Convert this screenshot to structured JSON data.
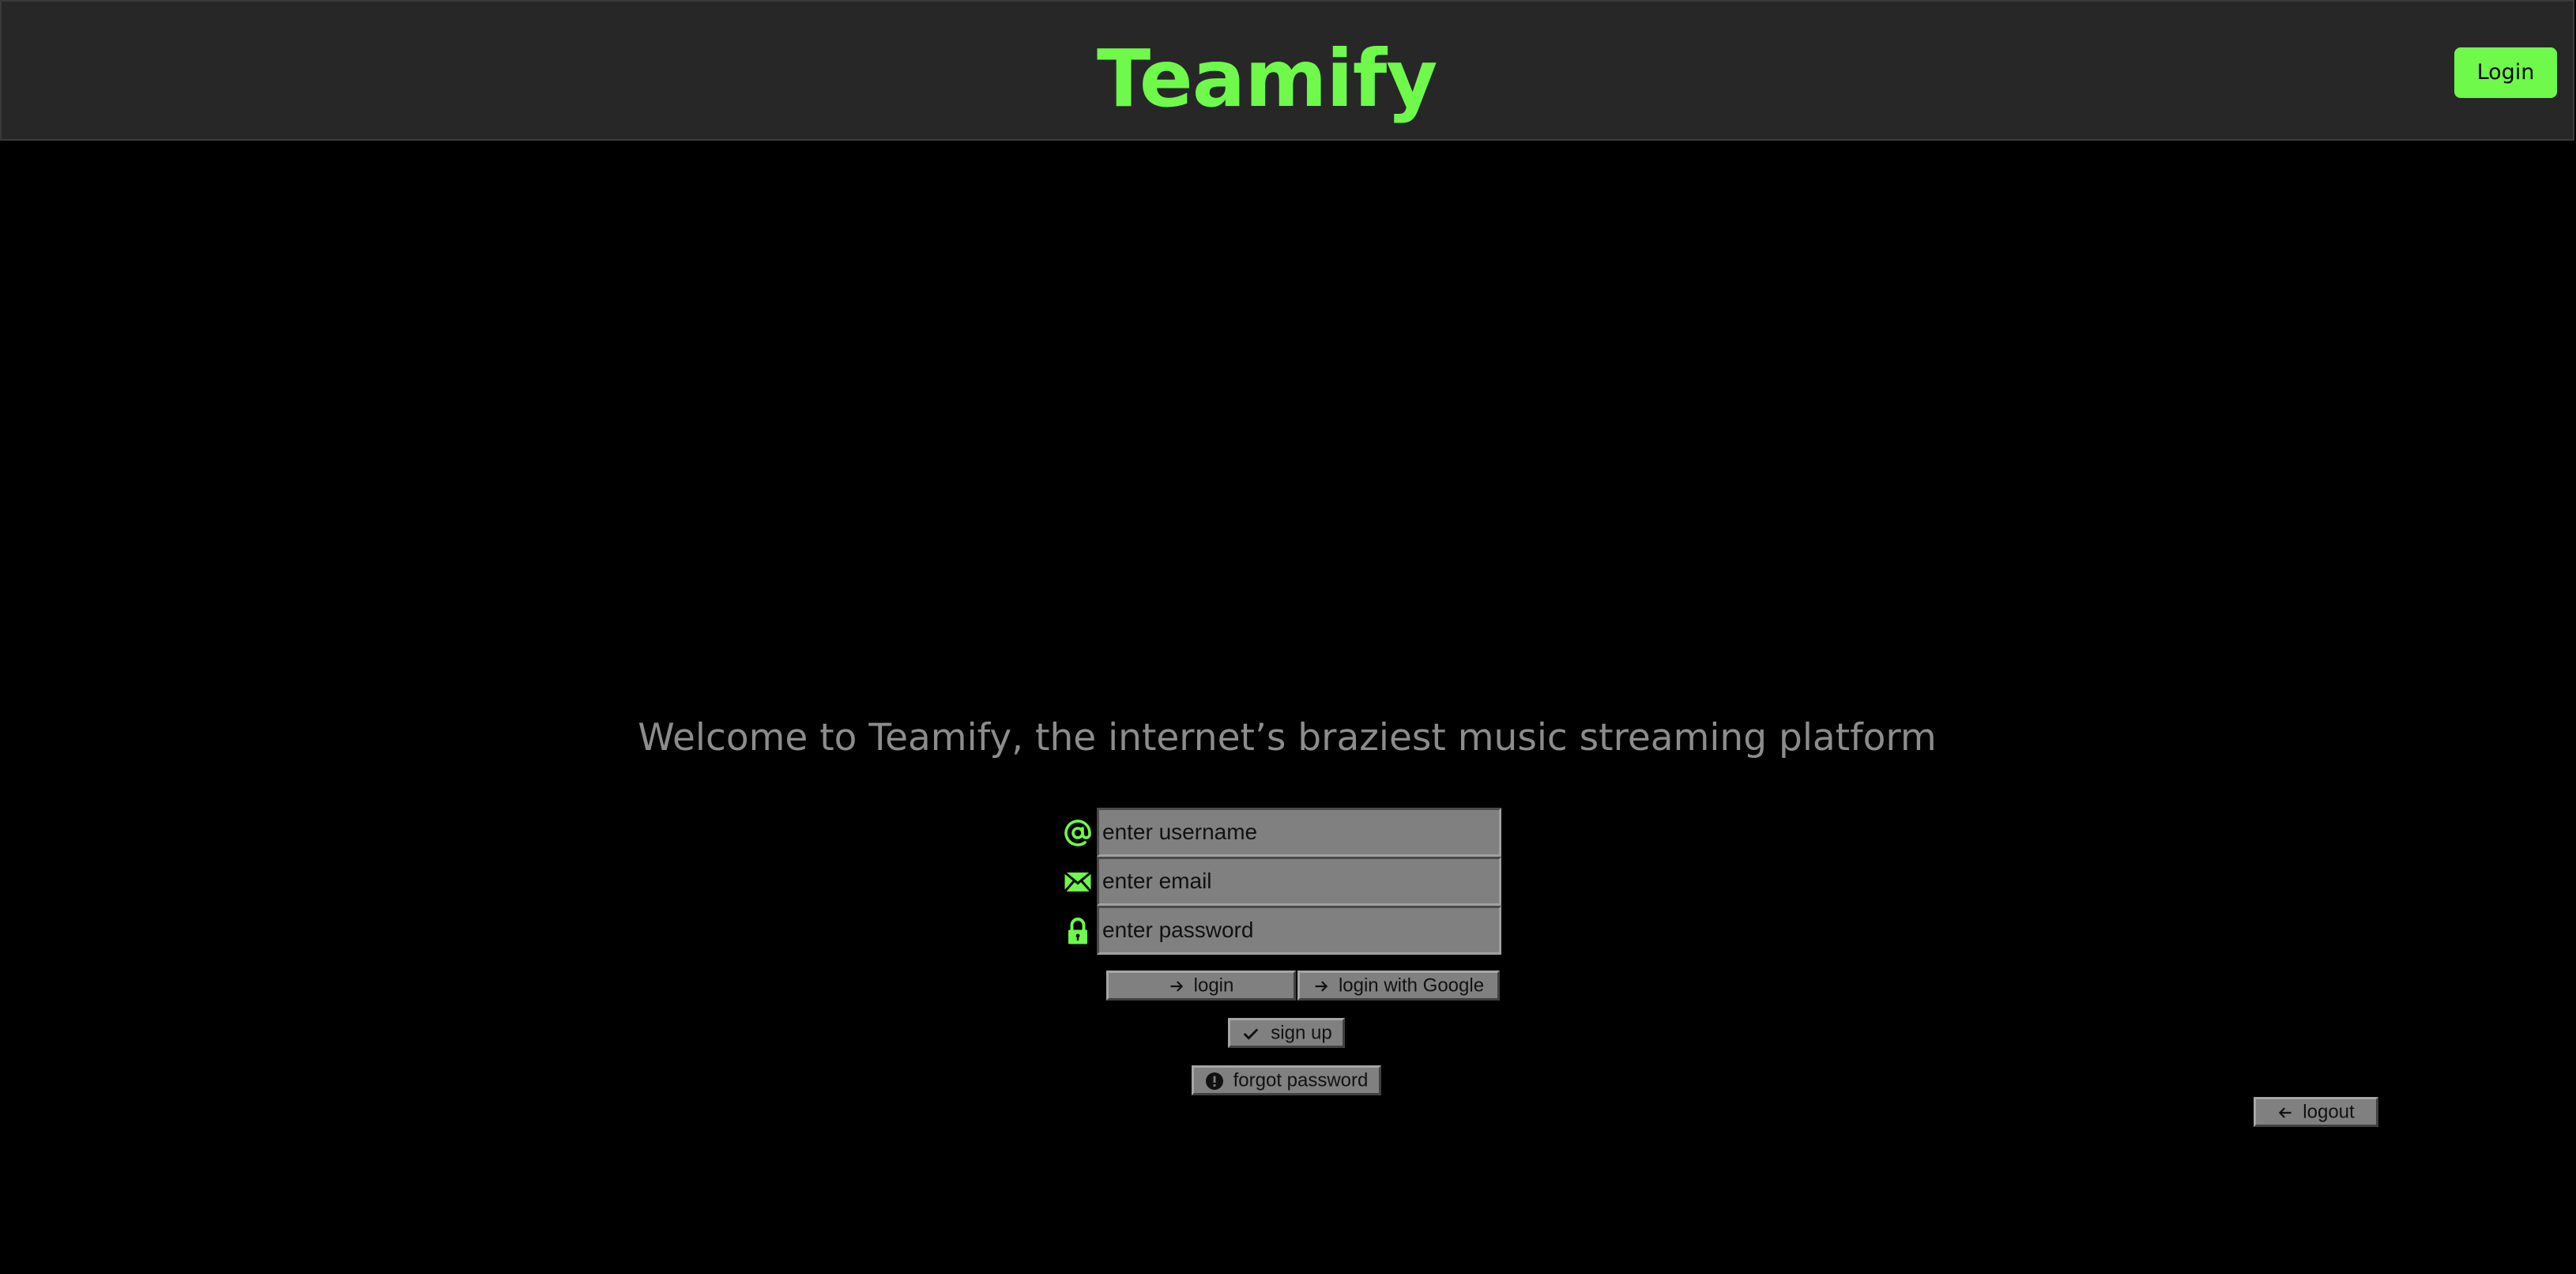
{
  "header": {
    "brand": "Teamify",
    "login_label": "Login"
  },
  "main": {
    "welcome": "Welcome to Teamify, the internet’s braziest music streaming platform",
    "fields": {
      "username_placeholder": "enter username",
      "email_placeholder": "enter email",
      "password_placeholder": "enter password"
    },
    "buttons": {
      "login": "login",
      "login_google": "login with Google",
      "signup": "sign up",
      "forgot": "forgot password",
      "logout": "logout"
    }
  },
  "icons": {
    "username": "at-icon",
    "email": "envelope-icon",
    "password": "lock-icon",
    "login": "arrow-right-icon",
    "login_google": "arrow-right-icon",
    "signup": "checkmark-icon",
    "forgot": "exclamation-circle-icon",
    "logout": "arrow-left-icon"
  },
  "colors": {
    "accent": "#6ff94b",
    "header_bg": "#272727",
    "page_bg": "#000000",
    "muted_text": "#8c8c8c",
    "control_gray": "#808080"
  }
}
